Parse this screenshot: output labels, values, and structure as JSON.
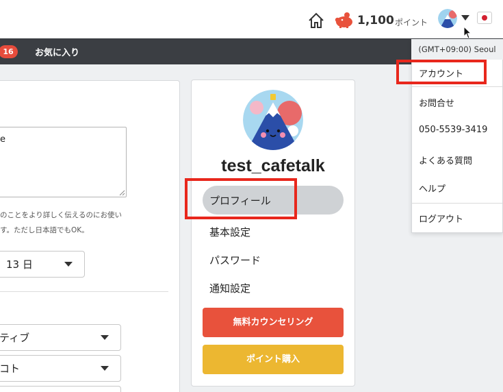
{
  "topbar": {
    "points_value": "1,100",
    "points_unit": "ポイント",
    "flag": "jp-flag-icon"
  },
  "navbar": {
    "badge_count": "16",
    "favorites_label": "お気に入り"
  },
  "form": {
    "textarea_value": "e",
    "hint_line1": "のことをより詳しく伝えるのにお使い",
    "hint_line2": "す。ただし日本語でもOK。",
    "day_select": "13 日",
    "colon": ":",
    "select_a": "ティブ",
    "select_b": "コト"
  },
  "profile": {
    "username": "test_cafetalk",
    "menu": [
      {
        "label": "プロフィール"
      },
      {
        "label": "基本設定"
      },
      {
        "label": "パスワード"
      },
      {
        "label": "通知設定"
      }
    ],
    "counsel_button": "無料カウンセリング",
    "points_button": "ポイント購入"
  },
  "dropdown": {
    "timezone": "(GMT+09:00) Seoul",
    "items": [
      {
        "label": "アカウント"
      },
      {
        "label": "お問合せ"
      },
      {
        "label": "050-5539-3419"
      },
      {
        "label": "よくある質問"
      },
      {
        "label": "ヘルプ"
      },
      {
        "label": "ログアウト"
      }
    ]
  },
  "colors": {
    "highlight": "#e8271c",
    "counsel": "#e8523c",
    "points": "#ecb731",
    "nav": "#3b3e43"
  }
}
